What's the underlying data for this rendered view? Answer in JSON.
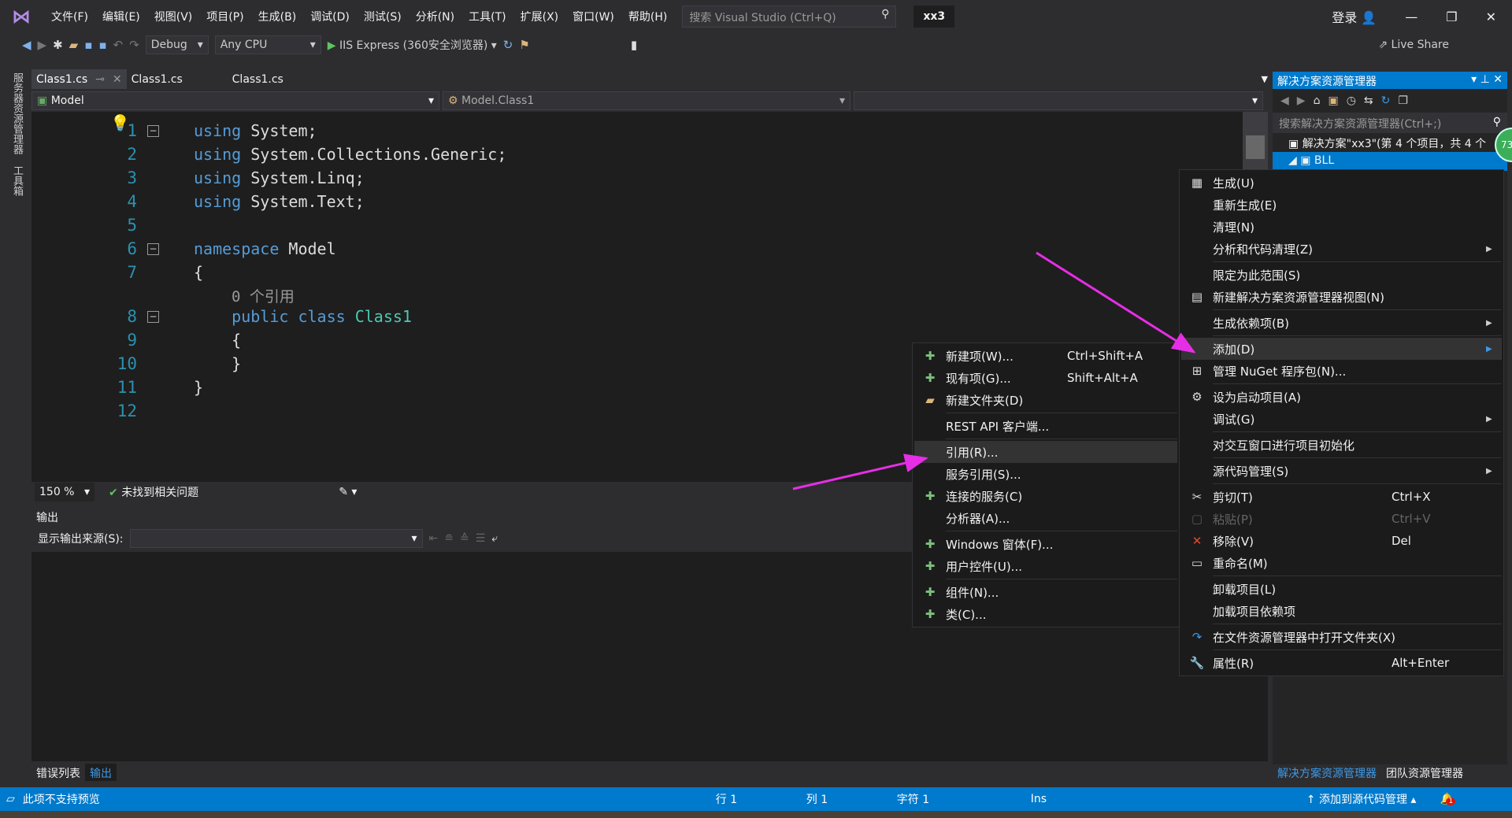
{
  "menubar": {
    "items": [
      "文件(F)",
      "编辑(E)",
      "视图(V)",
      "项目(P)",
      "生成(B)",
      "调试(D)",
      "测试(S)",
      "分析(N)",
      "工具(T)",
      "扩展(X)",
      "窗口(W)",
      "帮助(H)"
    ],
    "search_placeholder": "搜索 Visual Studio (Ctrl+Q)",
    "solution_name": "xx3",
    "login": "登录"
  },
  "toolbar": {
    "config": "Debug",
    "platform": "Any CPU",
    "run": "IIS Express (360安全浏览器)",
    "live_share": "Live Share"
  },
  "left_strip": {
    "tabs": [
      "服务器资源管理器",
      "工具箱"
    ]
  },
  "tabs": [
    {
      "label": "Class1.cs"
    },
    {
      "label": "Class1.cs"
    },
    {
      "label": "Class1.cs"
    }
  ],
  "navbar": {
    "project": "Model",
    "class": "Model.Class1",
    "member": ""
  },
  "editor": {
    "line_numbers": [
      "1",
      "2",
      "3",
      "4",
      "5",
      "6",
      "7",
      "8",
      "9",
      "10",
      "11",
      "12"
    ],
    "lines": [
      {
        "kw": "using",
        "rest": " System;"
      },
      {
        "kw": "using",
        "rest": " System.Collections.Generic;"
      },
      {
        "kw": "using",
        "rest": " System.Linq;"
      },
      {
        "kw": "using",
        "rest": " System.Text;"
      },
      {
        "kw": "",
        "rest": ""
      },
      {
        "kw": "namespace",
        "rest": " Model"
      },
      {
        "kw": "",
        "rest": "{"
      },
      {
        "kw": "    public class",
        "rest": " Class1"
      },
      {
        "kw": "",
        "rest": "    {"
      },
      {
        "kw": "",
        "rest": "    }"
      },
      {
        "kw": "",
        "rest": "}"
      },
      {
        "kw": "",
        "rest": ""
      }
    ],
    "codelens": "0 个引用"
  },
  "editor_status": {
    "zoom": "150 %",
    "issues": "未找到相关问题"
  },
  "output": {
    "title": "输出",
    "source_label": "显示输出来源(S):",
    "source_value": ""
  },
  "bottom_tabs": [
    "错误列表",
    "输出"
  ],
  "solution_explorer": {
    "title": "解决方案资源管理器",
    "search_placeholder": "搜索解决方案资源管理器(Ctrl+;)",
    "solution_row": "解决方案\"xx3\"(第 4 个项目，共 4 个",
    "selected_row": "BLL",
    "bottom_tabs": [
      "解决方案资源管理器",
      "团队资源管理器"
    ],
    "badge": "73"
  },
  "status": {
    "left": "此项不支持预览",
    "line": "行 1",
    "col": "列 1",
    "char": "字符 1",
    "mode": "Ins",
    "source_control": "添加到源代码管理",
    "notifications": "1"
  },
  "context_menu": [
    {
      "icon": "build-icon",
      "glyph": "▦",
      "label": "生成(U)"
    },
    {
      "label": "重新生成(E)"
    },
    {
      "label": "清理(N)"
    },
    {
      "label": "分析和代码清理(Z)",
      "submenu": true
    },
    {
      "sep": true
    },
    {
      "label": "限定为此范围(S)"
    },
    {
      "icon": "new-view-icon",
      "glyph": "▤",
      "label": "新建解决方案资源管理器视图(N)"
    },
    {
      "sep": true
    },
    {
      "label": "生成依赖项(B)",
      "submenu": true
    },
    {
      "sep": true
    },
    {
      "label": "添加(D)",
      "submenu": true,
      "highlight": true
    },
    {
      "icon": "nuget-icon",
      "glyph": "⊞",
      "label": "管理 NuGet 程序包(N)..."
    },
    {
      "sep": true
    },
    {
      "icon": "gear-icon",
      "glyph": "⚙",
      "label": "设为启动项目(A)"
    },
    {
      "label": "调试(G)",
      "submenu": true
    },
    {
      "sep": true
    },
    {
      "label": "对交互窗口进行项目初始化"
    },
    {
      "sep": true
    },
    {
      "label": "源代码管理(S)",
      "submenu": true
    },
    {
      "sep": true
    },
    {
      "icon": "cut-icon",
      "glyph": "✂",
      "label": "剪切(T)",
      "shortcut": "Ctrl+X"
    },
    {
      "icon": "paste-icon",
      "glyph": "▢",
      "label": "粘贴(P)",
      "shortcut": "Ctrl+V",
      "disabled": true
    },
    {
      "icon": "remove-icon",
      "glyph": "✕",
      "color": "#e8472c",
      "label": "移除(V)",
      "shortcut": "Del"
    },
    {
      "icon": "rename-icon",
      "glyph": "▭",
      "label": "重命名(M)"
    },
    {
      "sep": true
    },
    {
      "label": "卸载项目(L)"
    },
    {
      "label": "加载项目依赖项"
    },
    {
      "sep": true
    },
    {
      "icon": "open-folder-icon",
      "glyph": "↷",
      "color": "#3c9ae8",
      "label": "在文件资源管理器中打开文件夹(X)"
    },
    {
      "sep": true
    },
    {
      "icon": "wrench-icon",
      "glyph": "🔧",
      "label": "属性(R)",
      "shortcut": "Alt+Enter"
    }
  ],
  "add_submenu": [
    {
      "icon": "new-item-icon",
      "glyph": "✚",
      "label": "新建项(W)...",
      "shortcut": "Ctrl+Shift+A"
    },
    {
      "icon": "existing-item-icon",
      "glyph": "✚",
      "label": "现有项(G)...",
      "shortcut": "Shift+Alt+A"
    },
    {
      "icon": "new-folder-icon",
      "glyph": "▰",
      "color": "#dcb67a",
      "label": "新建文件夹(D)"
    },
    {
      "sep": true
    },
    {
      "label": "REST API 客户端..."
    },
    {
      "sep": true
    },
    {
      "label": "引用(R)...",
      "highlight": true
    },
    {
      "label": "服务引用(S)..."
    },
    {
      "icon": "connected-service-icon",
      "glyph": "✚",
      "label": "连接的服务(C)"
    },
    {
      "label": "分析器(A)..."
    },
    {
      "sep": true
    },
    {
      "icon": "windows-form-icon",
      "glyph": "✚",
      "label": "Windows 窗体(F)..."
    },
    {
      "icon": "user-control-icon",
      "glyph": "✚",
      "label": "用户控件(U)..."
    },
    {
      "sep": true
    },
    {
      "icon": "component-icon",
      "glyph": "✚",
      "label": "组件(N)..."
    },
    {
      "icon": "class-icon",
      "glyph": "✚",
      "label": "类(C)..."
    }
  ],
  "colors": {
    "accent": "#007acc",
    "annotation_arrow": "#e62ee6",
    "keyword": "#569cd6",
    "line_number": "#2b91af"
  }
}
